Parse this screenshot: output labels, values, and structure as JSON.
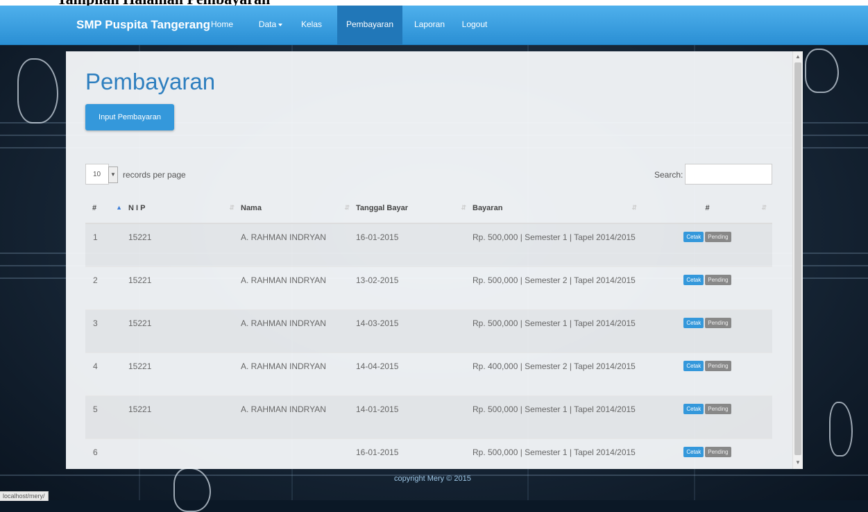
{
  "navbar": {
    "brand": "SMP Puspita Tangerang",
    "items": [
      {
        "label": "Home"
      },
      {
        "label": "Data"
      },
      {
        "label": "Kelas"
      },
      {
        "label": "Pembayaran"
      },
      {
        "label": "Laporan"
      },
      {
        "label": "Logout"
      }
    ],
    "active_item": "Pembayaran",
    "color": "#3a9fe0"
  },
  "page": {
    "title": "Pembayaran",
    "input_button": "Input Pembayaran"
  },
  "table_controls": {
    "per_page_value": "10",
    "per_page_label": "records per page",
    "search_label": "Search:",
    "search_value": ""
  },
  "table": {
    "headers": [
      "#",
      "N I P",
      "Nama",
      "Tanggal Bayar",
      "Bayaran",
      "#"
    ],
    "rows": [
      {
        "no": "1",
        "nip": "15221",
        "nama": "A. RAHMAN INDRYAN",
        "tanggal": "16-01-2015",
        "bayaran": "Rp. 500,000 | Semester 1 | Tapel 2014/2015"
      },
      {
        "no": "2",
        "nip": "15221",
        "nama": "A. RAHMAN INDRYAN",
        "tanggal": "13-02-2015",
        "bayaran": "Rp. 500,000 | Semester 2 | Tapel 2014/2015"
      },
      {
        "no": "3",
        "nip": "15221",
        "nama": "A. RAHMAN INDRYAN",
        "tanggal": "14-03-2015",
        "bayaran": "Rp. 500,000 | Semester 1 | Tapel 2014/2015"
      },
      {
        "no": "4",
        "nip": "15221",
        "nama": "A. RAHMAN INDRYAN",
        "tanggal": "14-04-2015",
        "bayaran": "Rp. 400,000 | Semester 2 | Tapel 2014/2015"
      },
      {
        "no": "5",
        "nip": "15221",
        "nama": "A. RAHMAN INDRYAN",
        "tanggal": "14-01-2015",
        "bayaran": "Rp. 500,000 | Semester 1 | Tapel 2014/2015"
      },
      {
        "no": "6",
        "nip": "",
        "nama": "",
        "tanggal": "16-01-2015",
        "bayaran": "Rp. 500,000 | Semester 1 | Tapel 2014/2015"
      }
    ],
    "action_primary": "Cetak",
    "action_secondary": "Pending"
  },
  "footer": {
    "text": "copyright Mery © 2015"
  },
  "status_bar": {
    "url": "localhost/mery/"
  },
  "colors": {
    "accent": "#3498db",
    "title": "#2e7fbf",
    "pending": "#888888"
  }
}
